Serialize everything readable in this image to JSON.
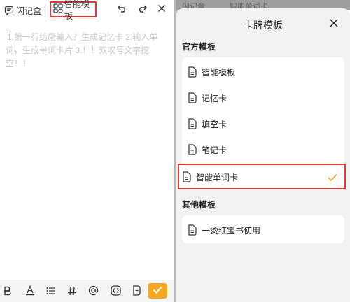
{
  "left": {
    "flash_box_label": "闪记盒",
    "template_label": "智能模板",
    "editor_text": "1.第一行结尾输入？生成记忆卡 2.输入单词，生成单词卡片 3.！！双叹号文字挖空！！",
    "toolbar_icons": [
      "bold-icon",
      "text-color-icon",
      "list-icon",
      "hashtag-icon",
      "mention-icon",
      "cloze-icon",
      "card-icon",
      "confirm-check-icon"
    ]
  },
  "right": {
    "ghost_tab1": "闪记盒",
    "ghost_tab2": "智能单词卡",
    "sheet_title": "卡牌模板",
    "official_section": "官方模板",
    "official_items": [
      "智能模板",
      "记忆卡",
      "填空卡",
      "笔记卡",
      "智能单词卡"
    ],
    "selected_item": "智能单词卡",
    "other_section": "其他模板",
    "other_items": [
      "一烫红宝书使用"
    ]
  },
  "colors": {
    "accent": "#f5a623",
    "highlight_border": "#e53935",
    "sheet_bg": "#f2f2f2",
    "placeholder": "#c8c8c8"
  }
}
